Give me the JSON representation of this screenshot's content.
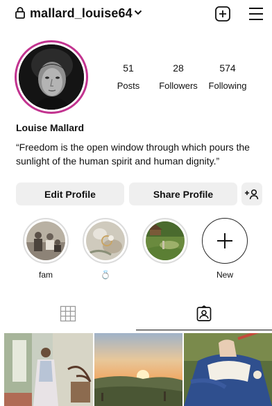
{
  "header": {
    "username": "mallard_louise64",
    "icons": {
      "lock": "lock-icon",
      "chevron": "chevron-down-icon",
      "create": "plus-square-icon",
      "menu": "hamburger-menu-icon"
    }
  },
  "profile": {
    "display_name": "Louise Mallard",
    "bio": "“Freedom is the open window through which pours the sunlight of the human spirit and human dignity.”",
    "ring_color": "#c2338f"
  },
  "stats": {
    "posts": {
      "count": "51",
      "label": "Posts"
    },
    "followers": {
      "count": "28",
      "label": "Followers"
    },
    "following": {
      "count": "574",
      "label": "Following"
    }
  },
  "actions": {
    "edit_label": "Edit Profile",
    "share_label": "Share Profile",
    "add_user_icon": "add-user-icon"
  },
  "highlights": [
    {
      "label": "fam"
    },
    {
      "label": "💍"
    },
    {
      "label": ""
    },
    {
      "label": "New"
    }
  ],
  "tabs": [
    {
      "icon": "grid-icon",
      "active": false
    },
    {
      "icon": "tagged-icon",
      "active": true
    }
  ],
  "colors": {
    "button_bg": "#efefef",
    "accent_ring": "#c2338f",
    "text": "#111111"
  }
}
